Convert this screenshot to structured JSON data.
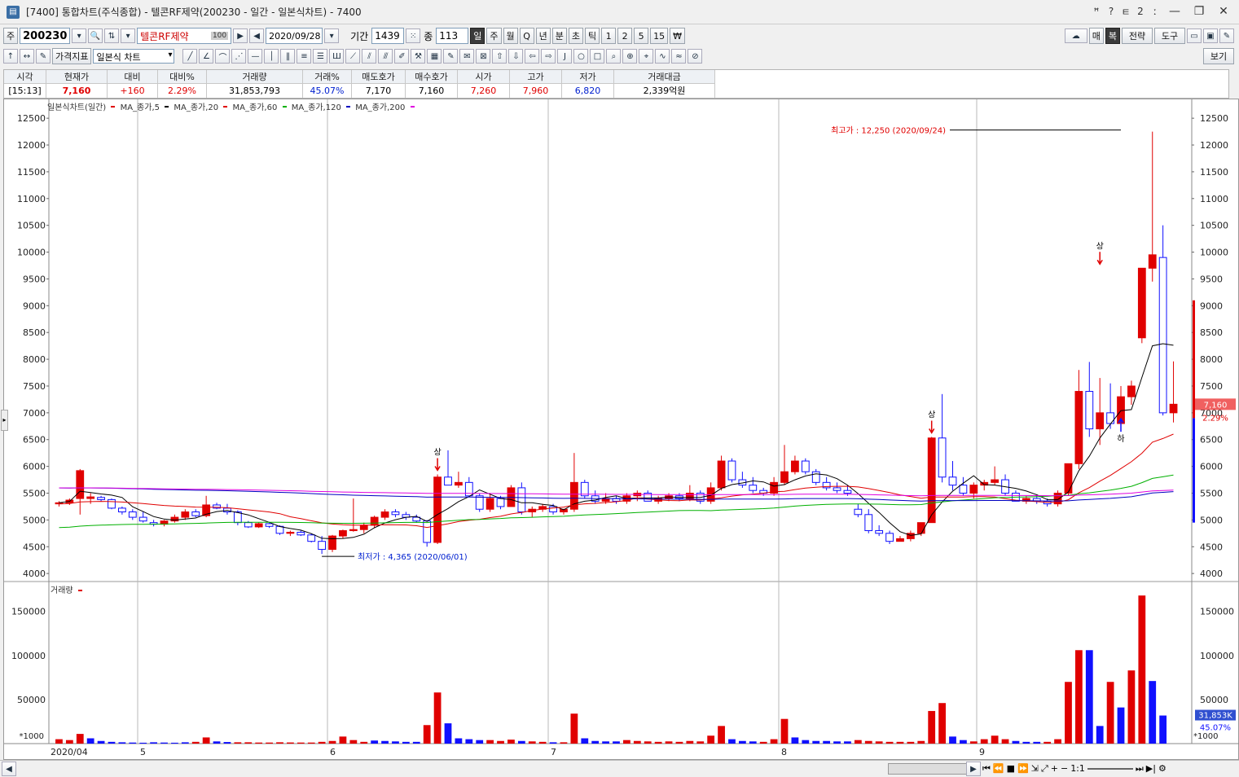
{
  "window": {
    "title": "[7400]  통합차트(주식종합)  - 텔콘RF제약(200230 - 일간 - 일본식차트)  - 7400",
    "controls": [
      "ꟸ",
      "?",
      "ㅌ",
      "2",
      "ː",
      "—",
      "❐",
      "✕"
    ]
  },
  "toolbar1": {
    "market": "주",
    "code": "200230",
    "stock_name": "텔콘RF제약",
    "pct_badge": "100",
    "date": "2020/09/28",
    "period_label": "기간",
    "period_value": "1439",
    "count_label": "종",
    "count_value": "113",
    "intervals": [
      "일",
      "주",
      "월",
      "Q",
      "년",
      "분",
      "초",
      "틱",
      "1",
      "2",
      "5",
      "15",
      "₩"
    ],
    "selected_interval": "일",
    "right_buttons": [
      "매",
      "복",
      "전략",
      "도구"
    ]
  },
  "toolbar2": {
    "indicator_button": "가격지표",
    "chart_type": "일본식 차트",
    "view_button": "보기"
  },
  "quote": {
    "headers": [
      "시각",
      "현재가",
      "대비",
      "대비%",
      "거래량",
      "거래%",
      "매도호가",
      "매수호가",
      "시가",
      "고가",
      "저가",
      "거래대금"
    ],
    "values": [
      "[15:13]",
      "7,160",
      "+160",
      "2.29%",
      "31,853,793",
      "45.07%",
      "7,170",
      "7,160",
      "7,260",
      "7,960",
      "6,820",
      "2,339억원"
    ]
  },
  "legend": {
    "main": "일본식차트(일간)",
    "items": [
      {
        "label": "MA_종가,5",
        "color": "#000000"
      },
      {
        "label": "MA_종가,20",
        "color": "#e00000"
      },
      {
        "label": "MA_종가,60",
        "color": "#00b000"
      },
      {
        "label": "MA_종가,120",
        "color": "#0000c0"
      },
      {
        "label": "MA_종가,200",
        "color": "#e000e0"
      }
    ],
    "volume": "거래량"
  },
  "annotations": {
    "high_label": "최고가 : 12,250 (2020/09/24)",
    "low_label": "최저가 : 4,365 (2020/06/01)",
    "upper_marker": "상",
    "lower_marker": "하",
    "last_price": "7,160",
    "last_pct": "2.29%",
    "vol_last": "31,853K",
    "vol_pct": "45.07%",
    "vol_unit": "*1000"
  },
  "chart_data": {
    "type": "candlestick",
    "price_ticks": [
      4000,
      4500,
      5000,
      5500,
      6000,
      6500,
      7000,
      7500,
      8000,
      8500,
      9000,
      9500,
      10000,
      10500,
      11000,
      11500,
      12000,
      12500
    ],
    "volume_ticks": [
      50000,
      100000,
      150000
    ],
    "x_labels": [
      "2020/04",
      "5",
      "6",
      "7",
      "8",
      "9"
    ],
    "ylim": [
      3850,
      12700
    ],
    "volume_ylim": [
      0,
      170000
    ],
    "candles": [
      [
        5300,
        5350,
        5250,
        5320
      ],
      [
        5320,
        5400,
        5280,
        5370
      ],
      [
        5400,
        5950,
        5100,
        5920
      ],
      [
        5400,
        5500,
        5300,
        5430
      ],
      [
        5420,
        5450,
        5350,
        5380
      ],
      [
        5380,
        5400,
        5200,
        5220
      ],
      [
        5220,
        5250,
        5100,
        5150
      ],
      [
        5150,
        5200,
        5000,
        5050
      ],
      [
        5050,
        5150,
        4950,
        4980
      ],
      [
        4950,
        5000,
        4880,
        4920
      ],
      [
        4920,
        5000,
        4880,
        4980
      ],
      [
        4980,
        5100,
        4950,
        5050
      ],
      [
        5050,
        5200,
        5000,
        5150
      ],
      [
        5150,
        5200,
        5050,
        5080
      ],
      [
        5080,
        5450,
        5050,
        5280
      ],
      [
        5280,
        5320,
        5200,
        5220
      ],
      [
        5220,
        5300,
        5100,
        5150
      ],
      [
        5150,
        5180,
        4900,
        4950
      ],
      [
        4950,
        4980,
        4850,
        4870
      ],
      [
        4870,
        4950,
        4850,
        4930
      ],
      [
        4930,
        4950,
        4850,
        4880
      ],
      [
        4880,
        4900,
        4720,
        4750
      ],
      [
        4750,
        4800,
        4700,
        4770
      ],
      [
        4770,
        4800,
        4700,
        4720
      ],
      [
        4720,
        4750,
        4580,
        4600
      ],
      [
        4600,
        4700,
        4365,
        4450
      ],
      [
        4450,
        4720,
        4400,
        4700
      ],
      [
        4700,
        4820,
        4650,
        4800
      ],
      [
        4800,
        5400,
        4780,
        4820
      ],
      [
        4820,
        4950,
        4750,
        4900
      ],
      [
        4900,
        5080,
        4850,
        5050
      ],
      [
        5050,
        5200,
        5000,
        5150
      ],
      [
        5150,
        5200,
        5050,
        5100
      ],
      [
        5100,
        5150,
        5000,
        5050
      ],
      [
        5050,
        5100,
        4950,
        4980
      ],
      [
        4980,
        5000,
        4500,
        4580
      ],
      [
        4580,
        5850,
        4550,
        5800
      ],
      [
        5800,
        6300,
        5700,
        5650
      ],
      [
        5650,
        5900,
        5600,
        5700
      ],
      [
        5700,
        5800,
        5450,
        5450
      ],
      [
        5450,
        5500,
        5150,
        5200
      ],
      [
        5200,
        5500,
        5150,
        5400
      ],
      [
        5400,
        5450,
        5200,
        5250
      ],
      [
        5250,
        5650,
        5250,
        5600
      ],
      [
        5600,
        5700,
        5100,
        5150
      ],
      [
        5150,
        5250,
        5050,
        5200
      ],
      [
        5200,
        5300,
        5150,
        5250
      ],
      [
        5250,
        5300,
        5100,
        5150
      ],
      [
        5150,
        5200,
        5100,
        5200
      ],
      [
        5200,
        6250,
        5150,
        5700
      ],
      [
        5700,
        5750,
        5400,
        5450
      ],
      [
        5450,
        5550,
        5300,
        5350
      ],
      [
        5350,
        5500,
        5300,
        5400
      ],
      [
        5400,
        5450,
        5300,
        5350
      ],
      [
        5350,
        5500,
        5300,
        5450
      ],
      [
        5450,
        5550,
        5350,
        5500
      ],
      [
        5500,
        5550,
        5350,
        5350
      ],
      [
        5350,
        5450,
        5300,
        5400
      ],
      [
        5400,
        5500,
        5350,
        5450
      ],
      [
        5450,
        5500,
        5350,
        5400
      ],
      [
        5400,
        5650,
        5350,
        5500
      ],
      [
        5500,
        5550,
        5300,
        5350
      ],
      [
        5350,
        5700,
        5300,
        5600
      ],
      [
        5600,
        6200,
        5550,
        6100
      ],
      [
        6100,
        6150,
        5700,
        5750
      ],
      [
        5750,
        5900,
        5600,
        5650
      ],
      [
        5650,
        5800,
        5500,
        5550
      ],
      [
        5550,
        5600,
        5450,
        5500
      ],
      [
        5500,
        5800,
        5450,
        5700
      ],
      [
        5700,
        6400,
        5650,
        5900
      ],
      [
        5900,
        6200,
        5850,
        6100
      ],
      [
        6100,
        6150,
        5850,
        5900
      ],
      [
        5900,
        5950,
        5650,
        5700
      ],
      [
        5700,
        5800,
        5550,
        5600
      ],
      [
        5600,
        5700,
        5500,
        5550
      ],
      [
        5550,
        5650,
        5450,
        5500
      ],
      [
        5200,
        5300,
        5050,
        5100
      ],
      [
        5100,
        5200,
        4750,
        4800
      ],
      [
        4800,
        4900,
        4700,
        4750
      ],
      [
        4750,
        4800,
        4550,
        4600
      ],
      [
        4600,
        4700,
        4600,
        4650
      ],
      [
        4650,
        4800,
        4600,
        4750
      ],
      [
        4750,
        4950,
        4700,
        4950
      ],
      [
        4950,
        6550,
        4950,
        6530
      ],
      [
        6530,
        7350,
        5700,
        5800
      ],
      [
        5800,
        6100,
        5550,
        5650
      ],
      [
        5650,
        5800,
        5450,
        5500
      ],
      [
        5500,
        5700,
        5400,
        5650
      ],
      [
        5650,
        5750,
        5550,
        5700
      ],
      [
        5700,
        6000,
        5650,
        5750
      ],
      [
        5750,
        5850,
        5450,
        5500
      ],
      [
        5500,
        5550,
        5350,
        5350
      ],
      [
        5350,
        5450,
        5300,
        5400
      ],
      [
        5400,
        5450,
        5300,
        5350
      ],
      [
        5350,
        5400,
        5250,
        5300
      ],
      [
        5300,
        5550,
        5250,
        5500
      ],
      [
        5500,
        6050,
        5450,
        6050
      ],
      [
        6050,
        7800,
        5950,
        7400
      ],
      [
        7400,
        7950,
        6550,
        6700
      ],
      [
        6700,
        7650,
        6400,
        7000
      ],
      [
        7000,
        7550,
        6700,
        6800
      ],
      [
        6800,
        7500,
        6750,
        7300
      ],
      [
        7300,
        7600,
        7150,
        7500
      ],
      [
        8400,
        9700,
        8300,
        9700
      ],
      [
        9700,
        12250,
        9450,
        9950
      ],
      [
        9900,
        10500,
        6950,
        7000
      ],
      [
        7000,
        7960,
        6820,
        7160
      ]
    ],
    "volumes": [
      [
        5000,
        1
      ],
      [
        4000,
        1
      ],
      [
        11000,
        1
      ],
      [
        6000,
        0
      ],
      [
        3000,
        0
      ],
      [
        2000,
        0
      ],
      [
        1500,
        0
      ],
      [
        1200,
        0
      ],
      [
        1000,
        0
      ],
      [
        1500,
        0
      ],
      [
        1200,
        0
      ],
      [
        1000,
        0
      ],
      [
        1500,
        0
      ],
      [
        2000,
        1
      ],
      [
        7000,
        1
      ],
      [
        2500,
        0
      ],
      [
        1800,
        0
      ],
      [
        1500,
        1
      ],
      [
        1500,
        1
      ],
      [
        1200,
        1
      ],
      [
        1200,
        1
      ],
      [
        1500,
        1
      ],
      [
        1300,
        1
      ],
      [
        1200,
        1
      ],
      [
        1200,
        1
      ],
      [
        2000,
        1
      ],
      [
        3000,
        1
      ],
      [
        8000,
        1
      ],
      [
        4000,
        1
      ],
      [
        2000,
        1
      ],
      [
        3500,
        0
      ],
      [
        3000,
        0
      ],
      [
        2500,
        0
      ],
      [
        2000,
        0
      ],
      [
        2000,
        0
      ],
      [
        21000,
        1
      ],
      [
        58000,
        1
      ],
      [
        23000,
        0
      ],
      [
        6000,
        0
      ],
      [
        5000,
        0
      ],
      [
        4000,
        0
      ],
      [
        4000,
        1
      ],
      [
        3000,
        1
      ],
      [
        4500,
        1
      ],
      [
        3000,
        0
      ],
      [
        2500,
        1
      ],
      [
        2000,
        1
      ],
      [
        1500,
        0
      ],
      [
        1500,
        1
      ],
      [
        34000,
        1
      ],
      [
        6000,
        0
      ],
      [
        3000,
        0
      ],
      [
        2500,
        0
      ],
      [
        2500,
        0
      ],
      [
        4000,
        1
      ],
      [
        3000,
        1
      ],
      [
        2500,
        1
      ],
      [
        2000,
        1
      ],
      [
        2500,
        1
      ],
      [
        2000,
        1
      ],
      [
        3000,
        1
      ],
      [
        2500,
        1
      ],
      [
        9000,
        1
      ],
      [
        20000,
        1
      ],
      [
        5000,
        0
      ],
      [
        3000,
        0
      ],
      [
        2500,
        0
      ],
      [
        2000,
        1
      ],
      [
        5000,
        1
      ],
      [
        28000,
        1
      ],
      [
        7000,
        0
      ],
      [
        4000,
        0
      ],
      [
        3000,
        0
      ],
      [
        3000,
        0
      ],
      [
        2500,
        0
      ],
      [
        2500,
        0
      ],
      [
        4000,
        1
      ],
      [
        3000,
        1
      ],
      [
        2500,
        1
      ],
      [
        2000,
        1
      ],
      [
        2000,
        1
      ],
      [
        2000,
        1
      ],
      [
        3000,
        1
      ],
      [
        37000,
        1
      ],
      [
        46000,
        1
      ],
      [
        8000,
        0
      ],
      [
        4000,
        0
      ],
      [
        2500,
        1
      ],
      [
        5000,
        1
      ],
      [
        9000,
        1
      ],
      [
        5000,
        1
      ],
      [
        3000,
        0
      ],
      [
        2000,
        0
      ],
      [
        2000,
        0
      ],
      [
        2000,
        1
      ],
      [
        5000,
        1
      ],
      [
        70000,
        1
      ],
      [
        106000,
        1
      ],
      [
        106000,
        0
      ],
      [
        20000,
        0
      ],
      [
        70000,
        1
      ],
      [
        41000,
        0
      ],
      [
        83000,
        1
      ],
      [
        168000,
        1
      ],
      [
        71000,
        0
      ],
      [
        31853,
        0
      ]
    ]
  }
}
